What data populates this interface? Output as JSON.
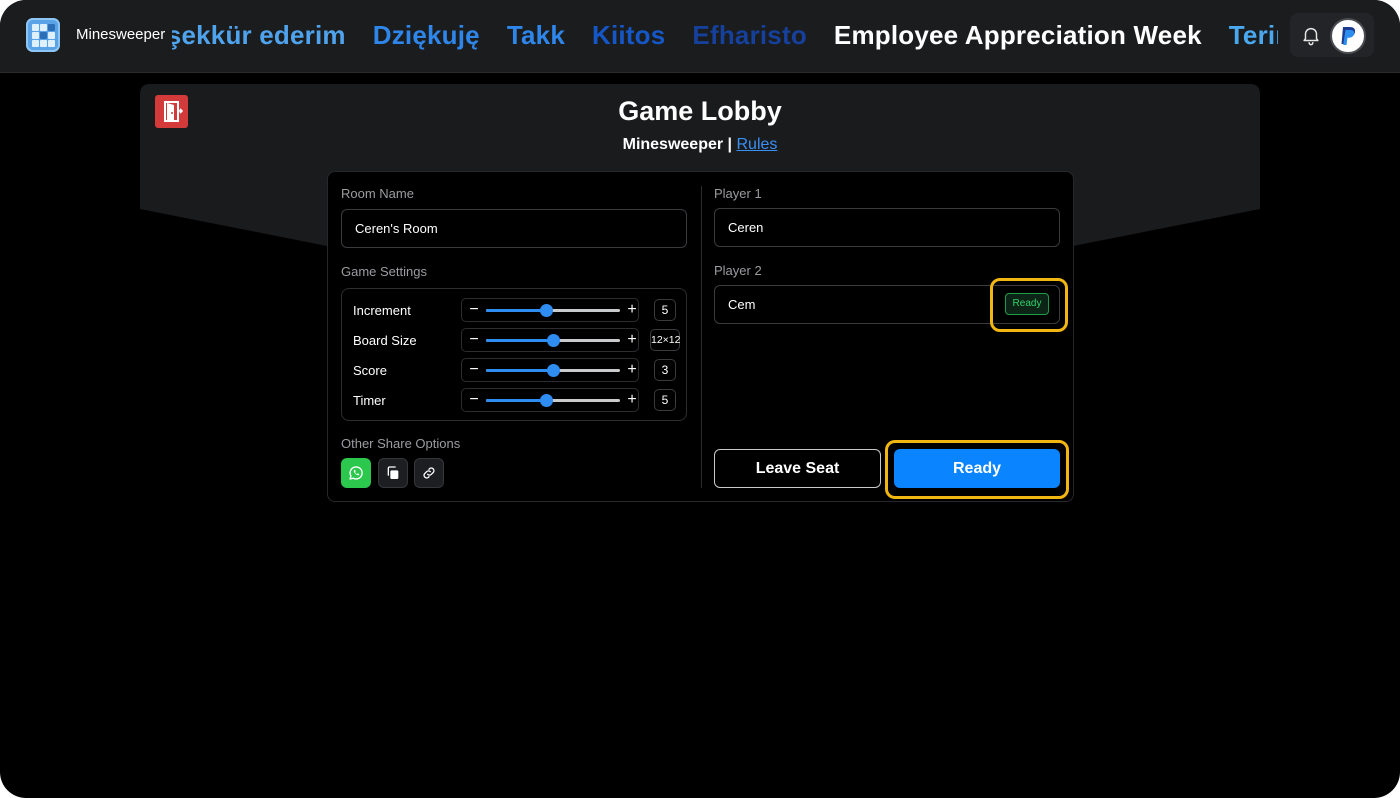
{
  "app": {
    "name": "Minesweeper",
    "icon": "minesweeper-grid-icon",
    "accent": "#0a84ff"
  },
  "marquee": {
    "items": [
      {
        "text": "Teşekkür ederim",
        "color": "#4fa3ec"
      },
      {
        "text": "Dziękuję",
        "color": "#2f86ea"
      },
      {
        "text": "Takk",
        "color": "#2f86ea"
      },
      {
        "text": "Kiitos",
        "color": "#1557c7"
      },
      {
        "text": "Efharisto",
        "color": "#15409b"
      },
      {
        "text": "Employee Appreciation Week",
        "color": "#ffffff"
      },
      {
        "text": "Terima kasih",
        "color": "#4aa8ee"
      }
    ]
  },
  "header_icons": {
    "notifications": "bell-icon",
    "account": "paypal-avatar-icon"
  },
  "lobby": {
    "title": "Game Lobby",
    "game_name": "Minesweeper",
    "separator": "|",
    "rules_link": "Rules",
    "exit_icon": "exit-door-icon"
  },
  "room": {
    "label": "Room Name",
    "value": "Ceren's Room"
  },
  "settings": {
    "label": "Game Settings",
    "items": [
      {
        "name": "Increment",
        "value": "5",
        "level": 0.45
      },
      {
        "name": "Board Size",
        "value": "12×12",
        "level": 0.5
      },
      {
        "name": "Score",
        "value": "3",
        "level": 0.5
      },
      {
        "name": "Timer",
        "value": "5",
        "level": 0.45
      }
    ],
    "minus": "−",
    "plus": "+"
  },
  "share": {
    "label": "Other Share Options",
    "buttons": [
      "whatsapp-icon",
      "copy-icon",
      "link-icon"
    ]
  },
  "players": {
    "p1_label": "Player 1",
    "p1_name": "Ceren",
    "p2_label": "Player 2",
    "p2_name": "Cem",
    "p2_status": "Ready"
  },
  "actions": {
    "leave": "Leave Seat",
    "ready": "Ready"
  },
  "colors": {
    "highlight": "#f2b612",
    "ready_badge": "#34d26a",
    "exit_button": "#d33b3b",
    "whatsapp": "#2cc84d"
  }
}
